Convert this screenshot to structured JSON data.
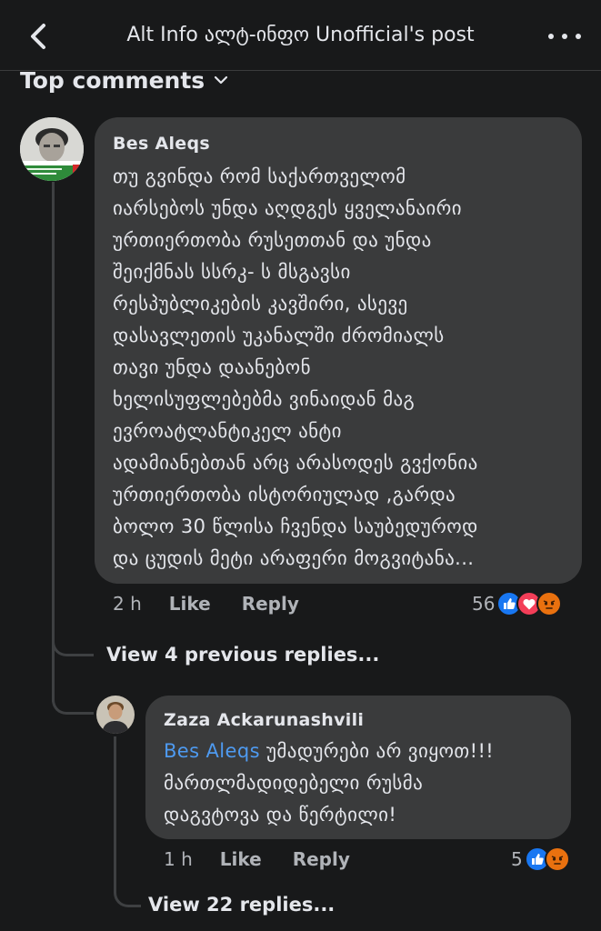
{
  "header": {
    "title": "Alt Info ალტ-ინფო Unofficial's post",
    "back_icon": "chevron-left-icon",
    "more_icon": "more-horizontal-icon"
  },
  "sort": {
    "label": "Top comments",
    "icon": "chevron-down-icon"
  },
  "comment": {
    "author": "Bes Aleqs",
    "lines": [
      "თუ გვინდა რომ საქართველომ",
      "იარსებოს უნდა აღდგეს ყველანაირი",
      "ურთიერთობა რუსეთთან და უნდა",
      "შეიქმნას სსრკ- ს მსგავსი",
      "რესპუბლიკების კავშირი, ასევე",
      "დასავლეთის უკანალში ძრომიალს",
      "თავი უნდა დაანებონ",
      "ხელისუფლებებმა ვინაიდან მაგ",
      "ევროატლანტიკელ ანტი",
      "ადამიანებთან არც არასოდეს გვქონია",
      "ურთიერთობა ისტორიულად ,გარდა",
      "ბოლო 30 წლისა ჩვენდა საუბედუროდ",
      "და ცუდის მეტი არაფერი მოგვიტანა..."
    ],
    "time": "2 h",
    "like_label": "Like",
    "reply_label": "Reply",
    "reaction_count": "56",
    "reactions": [
      "like",
      "love",
      "angry"
    ]
  },
  "view_previous": "View 4 previous replies...",
  "reply": {
    "author": "Zaza Ackarunashvili",
    "mention": "Bes Aleqs",
    "line1_rest": " უმადურები არ ვიყოთ!!!",
    "line2": "მართლმადიდებელი რუსმა",
    "line3": "დაგვტოვა და წერტილი!",
    "time": "1 h",
    "like_label": "Like",
    "reply_label": "Reply",
    "reaction_count": "5",
    "reactions": [
      "like",
      "angry"
    ]
  },
  "view_more_replies": "View 22 replies...",
  "colors": {
    "background": "#18191a",
    "bubble": "#3a3b3c",
    "mention": "#4e9af0",
    "like": "#1877f2",
    "love": "#f33e58",
    "angry": "#e9710f"
  }
}
